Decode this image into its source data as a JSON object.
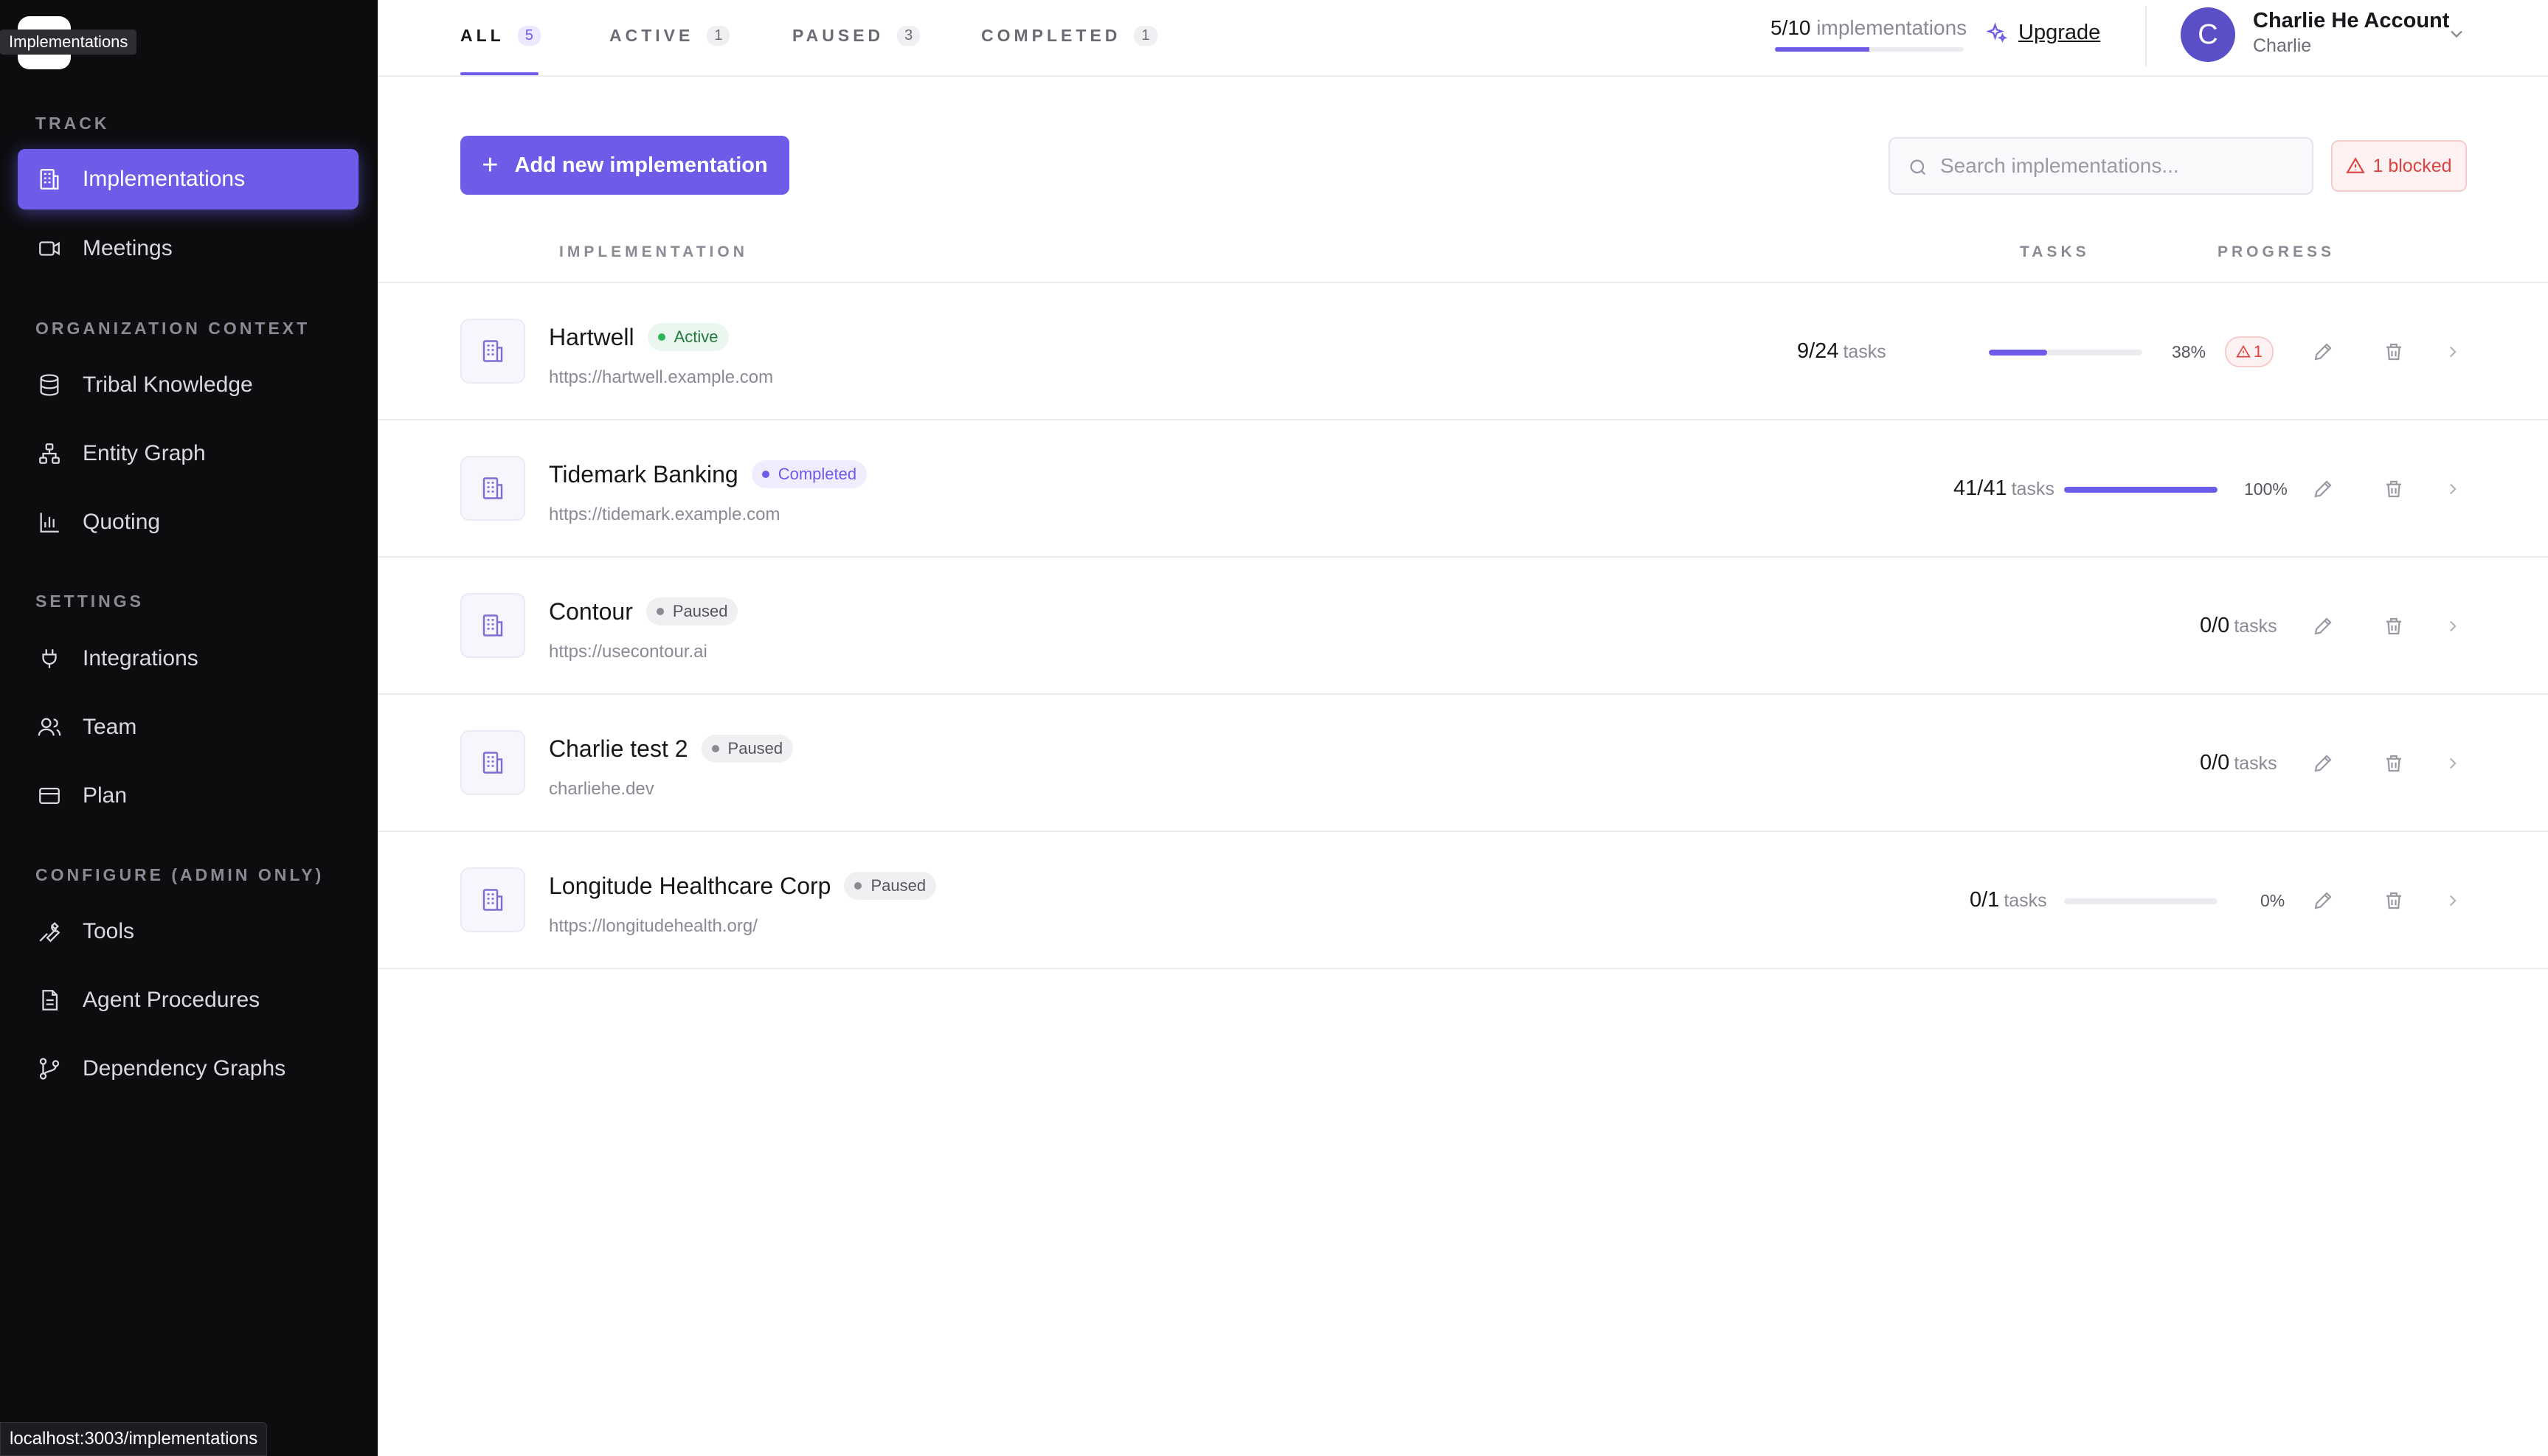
{
  "app": {
    "logo_text": "our",
    "tooltip": "Implementations",
    "status_url": "localhost:3003/implementations"
  },
  "sidebar": {
    "sections": [
      {
        "label": "TRACK"
      },
      {
        "label": "ORGANIZATION CONTEXT"
      },
      {
        "label": "SETTINGS"
      },
      {
        "label": "CONFIGURE (ADMIN ONLY)"
      }
    ],
    "items": [
      {
        "label": "Implementations",
        "icon": "building-icon"
      },
      {
        "label": "Meetings",
        "icon": "video-icon"
      },
      {
        "label": "Tribal Knowledge",
        "icon": "database-icon"
      },
      {
        "label": "Entity Graph",
        "icon": "graph-icon"
      },
      {
        "label": "Quoting",
        "icon": "bar-chart-icon"
      },
      {
        "label": "Integrations",
        "icon": "plug-icon"
      },
      {
        "label": "Team",
        "icon": "users-icon"
      },
      {
        "label": "Plan",
        "icon": "credit-card-icon"
      },
      {
        "label": "Tools",
        "icon": "wrench-icon"
      },
      {
        "label": "Agent Procedures",
        "icon": "document-icon"
      },
      {
        "label": "Dependency Graphs",
        "icon": "git-branch-icon"
      }
    ]
  },
  "tabs": [
    {
      "label": "ALL",
      "count": "5"
    },
    {
      "label": "ACTIVE",
      "count": "1"
    },
    {
      "label": "PAUSED",
      "count": "3"
    },
    {
      "label": "COMPLETED",
      "count": "1"
    }
  ],
  "header": {
    "quota_value": "5/10",
    "quota_label": "implementations",
    "quota_fraction": 0.5,
    "upgrade_label": "Upgrade",
    "account_name": "Charlie He Account",
    "account_sub": "Charlie",
    "avatar_initial": "C"
  },
  "toolbar": {
    "add_label": "Add new implementation",
    "search_placeholder": "Search implementations...",
    "blocked_label": "1 blocked"
  },
  "columns": {
    "implementation": "IMPLEMENTATION",
    "tasks": "TASKS",
    "progress": "PROGRESS"
  },
  "rows": [
    {
      "name": "Hartwell",
      "status": "Active",
      "url": "https://hartwell.example.com",
      "tasks": "9/24",
      "tasks_label": "tasks",
      "progress": 38,
      "progress_label": "38%",
      "warn_count": "1"
    },
    {
      "name": "Tidemark Banking",
      "status": "Completed",
      "url": "https://tidemark.example.com",
      "tasks": "41/41",
      "tasks_label": "tasks",
      "progress": 100,
      "progress_label": "100%"
    },
    {
      "name": "Contour",
      "status": "Paused",
      "url": "https://usecontour.ai",
      "tasks": "0/0",
      "tasks_label": "tasks"
    },
    {
      "name": "Charlie test 2",
      "status": "Paused",
      "url": "charliehe.dev",
      "tasks": "0/0",
      "tasks_label": "tasks"
    },
    {
      "name": "Longitude Healthcare Corp",
      "status": "Paused",
      "url": "https://longitudehealth.org/",
      "tasks": "0/1",
      "tasks_label": "tasks",
      "progress": 0,
      "progress_label": "0%"
    }
  ],
  "colors": {
    "accent": "#6c5ce7",
    "sidebar_bg": "#0d0d10",
    "danger": "#d9443f",
    "success": "#2fb55a"
  }
}
